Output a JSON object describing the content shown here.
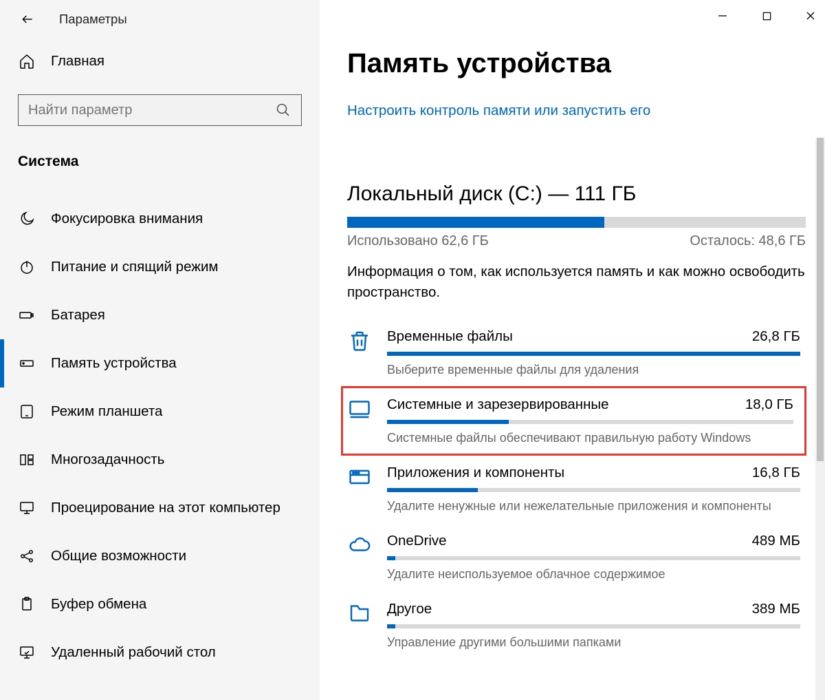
{
  "app_title": "Параметры",
  "home_label": "Главная",
  "search": {
    "placeholder": "Найти параметр"
  },
  "section_label": "Система",
  "nav": [
    {
      "id": "focus",
      "label": "Фокусировка внимания"
    },
    {
      "id": "power",
      "label": "Питание и спящий режим"
    },
    {
      "id": "battery",
      "label": "Батарея"
    },
    {
      "id": "storage",
      "label": "Память устройства",
      "active": true
    },
    {
      "id": "tablet",
      "label": "Режим планшета"
    },
    {
      "id": "multi",
      "label": "Многозадачность"
    },
    {
      "id": "proj",
      "label": "Проецирование на этот компьютер"
    },
    {
      "id": "shared",
      "label": "Общие возможности"
    },
    {
      "id": "clip",
      "label": "Буфер обмена"
    },
    {
      "id": "remote",
      "label": "Удаленный рабочий стол"
    }
  ],
  "page": {
    "title": "Память устройства",
    "config_link": "Настроить контроль памяти или запустить его",
    "disk_title": "Локальный диск (C:) — 111 ГБ",
    "used_label": "Использовано 62,6 ГБ",
    "free_label": "Осталось: 48,6 ГБ",
    "used_pct": 56,
    "info": "Информация о том, как используется память и как можно освободить пространство."
  },
  "categories": [
    {
      "id": "temp",
      "title": "Временные файлы",
      "size": "26,8 ГБ",
      "desc": "Выберите временные файлы для удаления",
      "pct": 100,
      "highlight": false
    },
    {
      "id": "system",
      "title": "Системные и зарезервированные",
      "size": "18,0 ГБ",
      "desc": "Системные файлы обеспечивают правильную работу Windows",
      "pct": 30,
      "highlight": true
    },
    {
      "id": "apps",
      "title": "Приложения и компоненты",
      "size": "16,8 ГБ",
      "desc": "Удалите ненужные или нежелательные приложения и компоненты",
      "pct": 22,
      "highlight": false
    },
    {
      "id": "onedrive",
      "title": "OneDrive",
      "size": "489 МБ",
      "desc": "Удалите неиспользуемое облачное содержимое",
      "pct": 2,
      "highlight": false
    },
    {
      "id": "other",
      "title": "Другое",
      "size": "389 МБ",
      "desc": "Управление другими большими папками",
      "pct": 2,
      "highlight": false
    }
  ]
}
